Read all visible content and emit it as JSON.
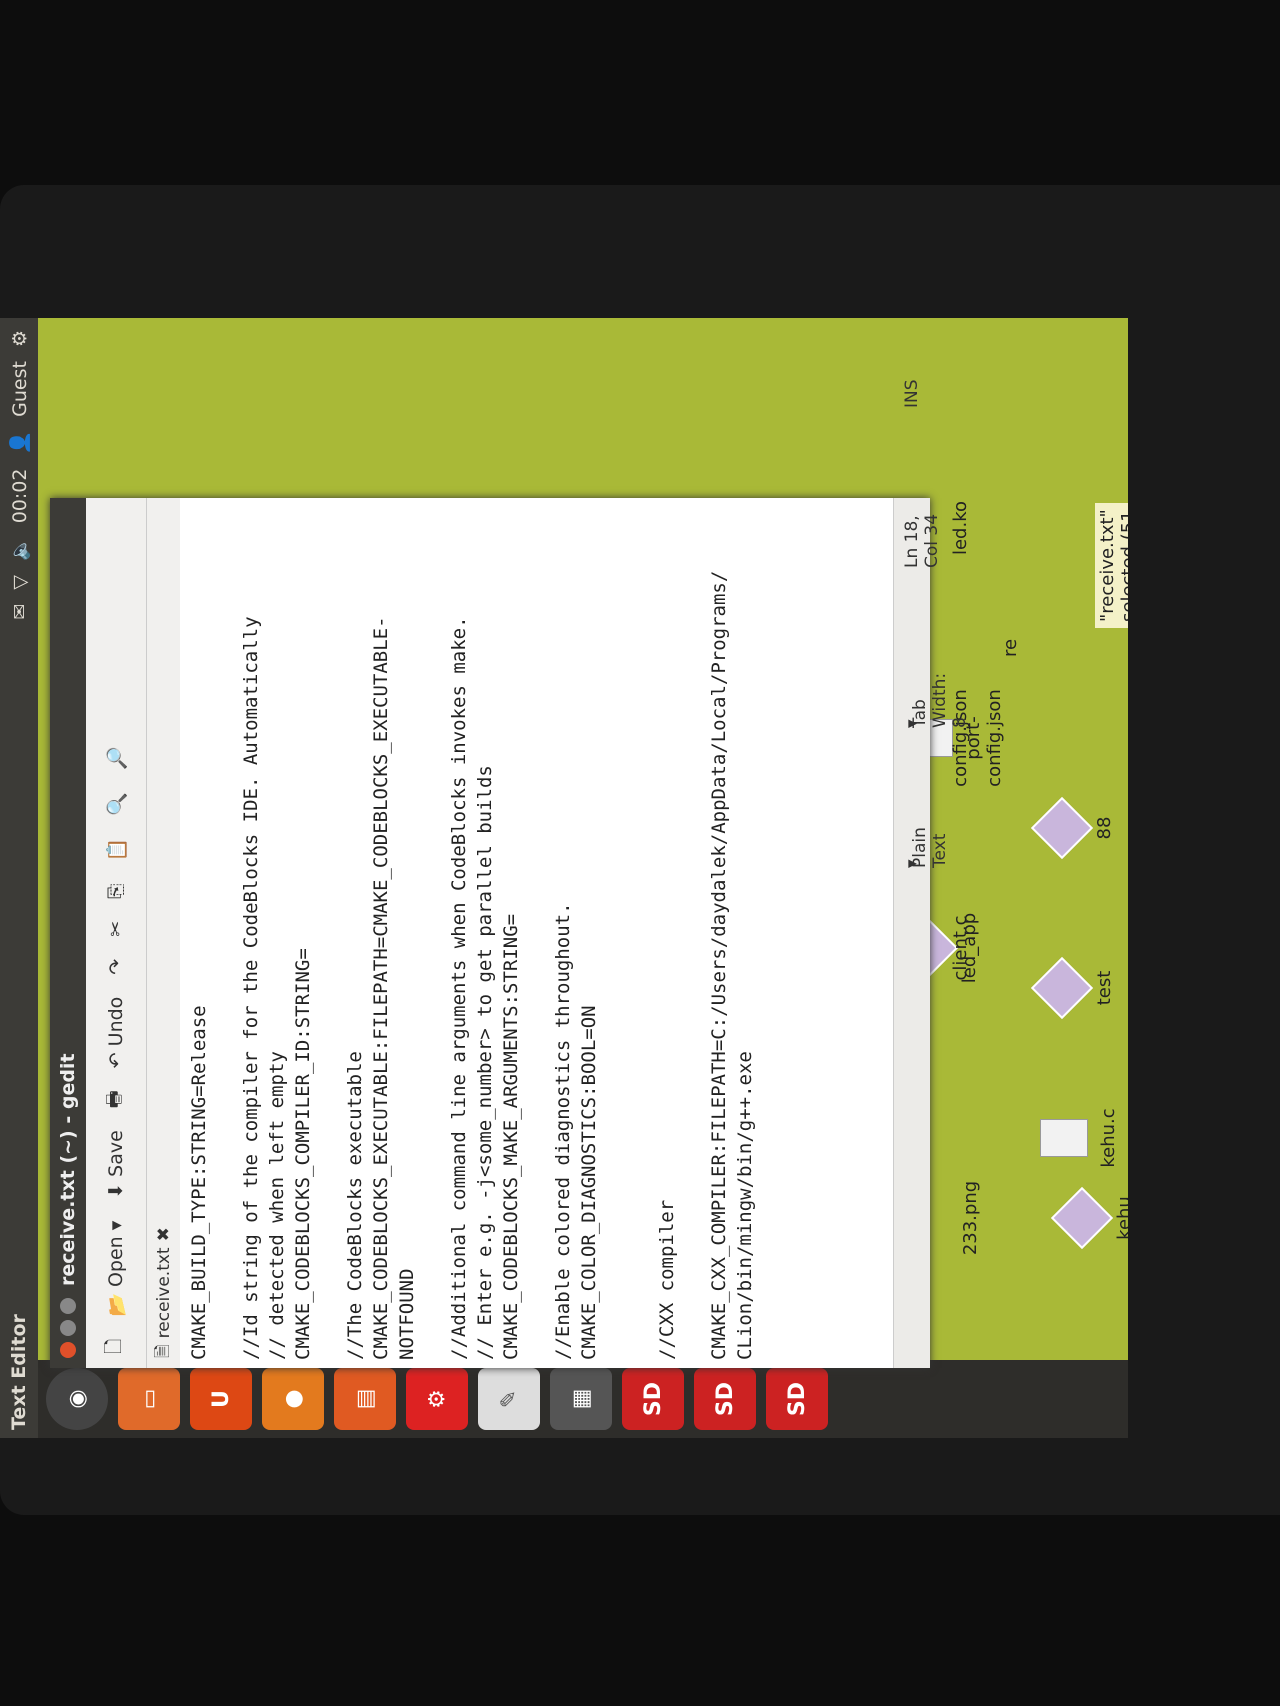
{
  "panel": {
    "title": "Text Editor",
    "clock": "00:02",
    "user": "Guest"
  },
  "window": {
    "title": "receive.txt (~) - gedit",
    "tab_label": "receive.txt"
  },
  "toolbar": {
    "open_label": "Open",
    "save_label": "Save",
    "undo_label": "Undo"
  },
  "editor": {
    "lines": [
      "CMAKE_BUILD_TYPE:STRING=Release",
      "",
      "//Id string of the compiler for the CodeBlocks IDE. Automatically",
      "// detected when left empty",
      "CMAKE_CODEBLOCKS_COMPILER_ID:STRING=",
      "",
      "//The CodeBlocks executable",
      "CMAKE_CODEBLOCKS_EXECUTABLE:FILEPATH=CMAKE_CODEBLOCKS_EXECUTABLE-",
      "NOTFOUND",
      "",
      "//Additional command line arguments when CodeBlocks invokes make.",
      "// Enter e.g. -j<some_number> to get parallel builds",
      "CMAKE_CODEBLOCKS_MAKE_ARGUMENTS:STRING=",
      "",
      "//Enable colored diagnostics throughout.",
      "CMAKE_COLOR_DIAGNOSTICS:BOOL=ON",
      "",
      "",
      "//CXX compiler",
      "",
      "CMAKE_CXX_COMPILER:FILEPATH=C:/Users/daydalek/AppData/Local/Programs/",
      "CLion/bin/mingw/bin/g++.exe"
    ]
  },
  "status": {
    "lang": "Plain Text",
    "tab_width": "Tab Width: 8",
    "position": "Ln 18, Col 34",
    "mode": "INS"
  },
  "files": {
    "client": "client.c",
    "config": "config.json",
    "ledko": "led.ko",
    "ledapp": "led_app",
    "portconfig": "port-config.json",
    "test": "test",
    "n88": "88",
    "kehu": "kehu",
    "kehuc": "kehu.c",
    "png": "233.png",
    "re": "re"
  },
  "selection_text": "\"receive.txt\" selected (51"
}
